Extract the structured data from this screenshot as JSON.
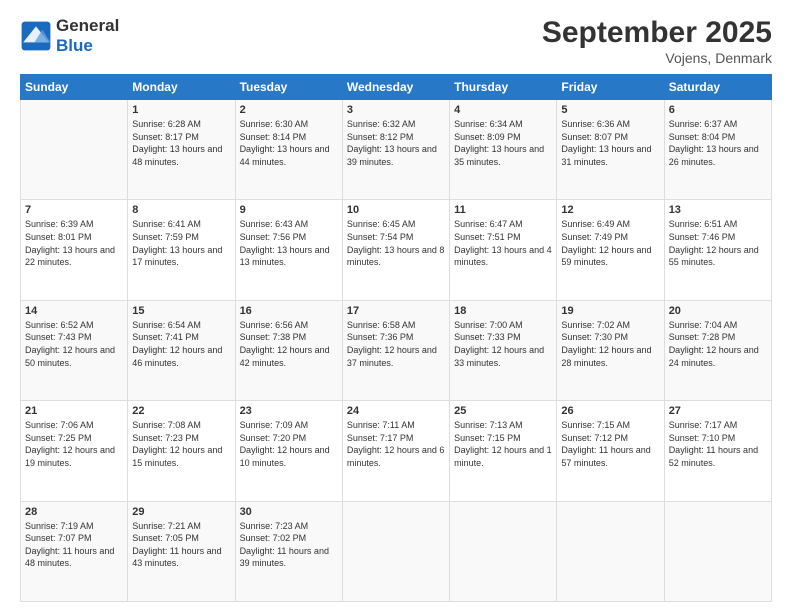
{
  "logo": {
    "line1": "General",
    "line2": "Blue"
  },
  "title": "September 2025",
  "subtitle": "Vojens, Denmark",
  "header_days": [
    "Sunday",
    "Monday",
    "Tuesday",
    "Wednesday",
    "Thursday",
    "Friday",
    "Saturday"
  ],
  "weeks": [
    [
      {
        "day": "",
        "sunrise": "",
        "sunset": "",
        "daylight": ""
      },
      {
        "day": "1",
        "sunrise": "Sunrise: 6:28 AM",
        "sunset": "Sunset: 8:17 PM",
        "daylight": "Daylight: 13 hours and 48 minutes."
      },
      {
        "day": "2",
        "sunrise": "Sunrise: 6:30 AM",
        "sunset": "Sunset: 8:14 PM",
        "daylight": "Daylight: 13 hours and 44 minutes."
      },
      {
        "day": "3",
        "sunrise": "Sunrise: 6:32 AM",
        "sunset": "Sunset: 8:12 PM",
        "daylight": "Daylight: 13 hours and 39 minutes."
      },
      {
        "day": "4",
        "sunrise": "Sunrise: 6:34 AM",
        "sunset": "Sunset: 8:09 PM",
        "daylight": "Daylight: 13 hours and 35 minutes."
      },
      {
        "day": "5",
        "sunrise": "Sunrise: 6:36 AM",
        "sunset": "Sunset: 8:07 PM",
        "daylight": "Daylight: 13 hours and 31 minutes."
      },
      {
        "day": "6",
        "sunrise": "Sunrise: 6:37 AM",
        "sunset": "Sunset: 8:04 PM",
        "daylight": "Daylight: 13 hours and 26 minutes."
      }
    ],
    [
      {
        "day": "7",
        "sunrise": "Sunrise: 6:39 AM",
        "sunset": "Sunset: 8:01 PM",
        "daylight": "Daylight: 13 hours and 22 minutes."
      },
      {
        "day": "8",
        "sunrise": "Sunrise: 6:41 AM",
        "sunset": "Sunset: 7:59 PM",
        "daylight": "Daylight: 13 hours and 17 minutes."
      },
      {
        "day": "9",
        "sunrise": "Sunrise: 6:43 AM",
        "sunset": "Sunset: 7:56 PM",
        "daylight": "Daylight: 13 hours and 13 minutes."
      },
      {
        "day": "10",
        "sunrise": "Sunrise: 6:45 AM",
        "sunset": "Sunset: 7:54 PM",
        "daylight": "Daylight: 13 hours and 8 minutes."
      },
      {
        "day": "11",
        "sunrise": "Sunrise: 6:47 AM",
        "sunset": "Sunset: 7:51 PM",
        "daylight": "Daylight: 13 hours and 4 minutes."
      },
      {
        "day": "12",
        "sunrise": "Sunrise: 6:49 AM",
        "sunset": "Sunset: 7:49 PM",
        "daylight": "Daylight: 12 hours and 59 minutes."
      },
      {
        "day": "13",
        "sunrise": "Sunrise: 6:51 AM",
        "sunset": "Sunset: 7:46 PM",
        "daylight": "Daylight: 12 hours and 55 minutes."
      }
    ],
    [
      {
        "day": "14",
        "sunrise": "Sunrise: 6:52 AM",
        "sunset": "Sunset: 7:43 PM",
        "daylight": "Daylight: 12 hours and 50 minutes."
      },
      {
        "day": "15",
        "sunrise": "Sunrise: 6:54 AM",
        "sunset": "Sunset: 7:41 PM",
        "daylight": "Daylight: 12 hours and 46 minutes."
      },
      {
        "day": "16",
        "sunrise": "Sunrise: 6:56 AM",
        "sunset": "Sunset: 7:38 PM",
        "daylight": "Daylight: 12 hours and 42 minutes."
      },
      {
        "day": "17",
        "sunrise": "Sunrise: 6:58 AM",
        "sunset": "Sunset: 7:36 PM",
        "daylight": "Daylight: 12 hours and 37 minutes."
      },
      {
        "day": "18",
        "sunrise": "Sunrise: 7:00 AM",
        "sunset": "Sunset: 7:33 PM",
        "daylight": "Daylight: 12 hours and 33 minutes."
      },
      {
        "day": "19",
        "sunrise": "Sunrise: 7:02 AM",
        "sunset": "Sunset: 7:30 PM",
        "daylight": "Daylight: 12 hours and 28 minutes."
      },
      {
        "day": "20",
        "sunrise": "Sunrise: 7:04 AM",
        "sunset": "Sunset: 7:28 PM",
        "daylight": "Daylight: 12 hours and 24 minutes."
      }
    ],
    [
      {
        "day": "21",
        "sunrise": "Sunrise: 7:06 AM",
        "sunset": "Sunset: 7:25 PM",
        "daylight": "Daylight: 12 hours and 19 minutes."
      },
      {
        "day": "22",
        "sunrise": "Sunrise: 7:08 AM",
        "sunset": "Sunset: 7:23 PM",
        "daylight": "Daylight: 12 hours and 15 minutes."
      },
      {
        "day": "23",
        "sunrise": "Sunrise: 7:09 AM",
        "sunset": "Sunset: 7:20 PM",
        "daylight": "Daylight: 12 hours and 10 minutes."
      },
      {
        "day": "24",
        "sunrise": "Sunrise: 7:11 AM",
        "sunset": "Sunset: 7:17 PM",
        "daylight": "Daylight: 12 hours and 6 minutes."
      },
      {
        "day": "25",
        "sunrise": "Sunrise: 7:13 AM",
        "sunset": "Sunset: 7:15 PM",
        "daylight": "Daylight: 12 hours and 1 minute."
      },
      {
        "day": "26",
        "sunrise": "Sunrise: 7:15 AM",
        "sunset": "Sunset: 7:12 PM",
        "daylight": "Daylight: 11 hours and 57 minutes."
      },
      {
        "day": "27",
        "sunrise": "Sunrise: 7:17 AM",
        "sunset": "Sunset: 7:10 PM",
        "daylight": "Daylight: 11 hours and 52 minutes."
      }
    ],
    [
      {
        "day": "28",
        "sunrise": "Sunrise: 7:19 AM",
        "sunset": "Sunset: 7:07 PM",
        "daylight": "Daylight: 11 hours and 48 minutes."
      },
      {
        "day": "29",
        "sunrise": "Sunrise: 7:21 AM",
        "sunset": "Sunset: 7:05 PM",
        "daylight": "Daylight: 11 hours and 43 minutes."
      },
      {
        "day": "30",
        "sunrise": "Sunrise: 7:23 AM",
        "sunset": "Sunset: 7:02 PM",
        "daylight": "Daylight: 11 hours and 39 minutes."
      },
      {
        "day": "",
        "sunrise": "",
        "sunset": "",
        "daylight": ""
      },
      {
        "day": "",
        "sunrise": "",
        "sunset": "",
        "daylight": ""
      },
      {
        "day": "",
        "sunrise": "",
        "sunset": "",
        "daylight": ""
      },
      {
        "day": "",
        "sunrise": "",
        "sunset": "",
        "daylight": ""
      }
    ]
  ]
}
